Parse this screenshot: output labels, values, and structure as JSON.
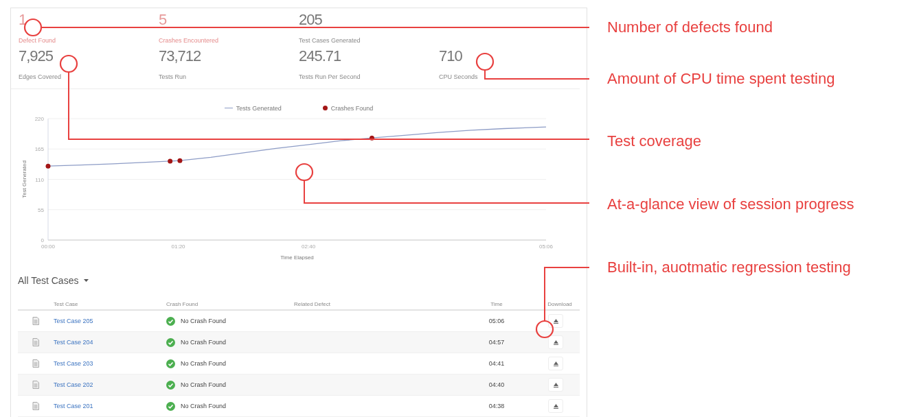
{
  "stat_rows": [
    [
      {
        "value": "1",
        "label": "Defect Found",
        "kind": "alert"
      },
      {
        "value": "5",
        "label": "Crashes Encountered",
        "kind": "alert"
      },
      {
        "value": "205",
        "label": "Test Cases Generated",
        "kind": "normal"
      }
    ],
    [
      {
        "value": "7,925",
        "label": "Edges Covered",
        "kind": "normal"
      },
      {
        "value": "73,712",
        "label": "Tests Run",
        "kind": "normal"
      },
      {
        "value": "245.71",
        "label": "Tests Run Per Second",
        "kind": "normal"
      },
      {
        "value": "710",
        "label": "CPU Seconds",
        "kind": "normal"
      }
    ]
  ],
  "chart": {
    "chart_data": {
      "type": "line",
      "grid": true,
      "xlabel": "Time Elapsed",
      "ylabel": "Test Generated",
      "x": [
        0,
        20,
        40,
        60,
        75,
        81,
        100,
        120,
        140,
        160,
        180,
        199,
        220,
        240,
        260,
        280,
        306
      ],
      "xlim": [
        0,
        306
      ],
      "ylim": [
        0,
        220
      ],
      "yticks": [
        0,
        55,
        110,
        165,
        220
      ],
      "xticks": [
        {
          "value": 0,
          "label": "00:00"
        },
        {
          "value": 80,
          "label": "01:20"
        },
        {
          "value": 160,
          "label": "02:40"
        },
        {
          "value": 306,
          "label": "05:06"
        }
      ],
      "series": [
        {
          "name": "Tests Generated",
          "color": "#8d9cc6",
          "values": [
            134,
            136,
            138,
            141,
            143,
            144,
            150,
            158,
            166,
            173,
            180,
            185,
            190,
            195,
            199,
            202,
            205
          ]
        },
        {
          "name": "Crashes Found",
          "type": "scatter",
          "color": "#a31616",
          "values": [
            134,
            null,
            null,
            null,
            143,
            144,
            null,
            null,
            null,
            null,
            null,
            185,
            null,
            null,
            null,
            null,
            null
          ]
        }
      ]
    }
  },
  "test_cases": {
    "filter": "All Test Cases",
    "columns": [
      "Test Case",
      "Crash Found",
      "Related Defect",
      "Time",
      "Download"
    ],
    "rows": [
      {
        "test_case": "Test Case 205",
        "crash_found": "No Crash Found",
        "crashed": false,
        "time": "05:06"
      },
      {
        "test_case": "Test Case 204",
        "crash_found": "No Crash Found",
        "crashed": false,
        "time": "04:57"
      },
      {
        "test_case": "Test Case 203",
        "crash_found": "No Crash Found",
        "crashed": false,
        "time": "04:41"
      },
      {
        "test_case": "Test Case 202",
        "crash_found": "No Crash Found",
        "crashed": false,
        "time": "04:40"
      },
      {
        "test_case": "Test Case 201",
        "crash_found": "No Crash Found",
        "crashed": false,
        "time": "04:38"
      }
    ]
  },
  "annotations": [
    {
      "text": "Number of defects found"
    },
    {
      "text": "Amount of CPU time spent testing"
    },
    {
      "text": "Test coverage"
    },
    {
      "text": "At-a-glance view of session progress"
    },
    {
      "text": "Built-in, auotmatic regression testing"
    }
  ]
}
